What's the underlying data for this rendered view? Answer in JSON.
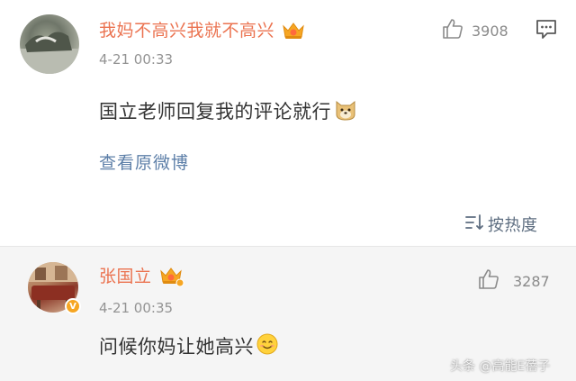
{
  "comment1": {
    "username": "我妈不高兴我就不高兴",
    "time": "4-21 00:33",
    "text": "国立老师回复我的评论就行",
    "likes": "3908",
    "view_original": "查看原微博"
  },
  "sort": {
    "label": "按热度"
  },
  "reply": {
    "username": "张国立",
    "time": "4-21 00:35",
    "text": "问候你妈让她高兴",
    "likes": "3287"
  },
  "watermark": "头条 @高能E蓓子",
  "icons": {
    "like": "thumbs-up-icon",
    "comment": "comment-icon",
    "sort": "sort-icon",
    "crown": "vip-crown-icon",
    "emoji_doge": "doge-emoji-icon",
    "emoji_smile": "smile-emoji-icon",
    "verified": "verified-v-icon"
  },
  "colors": {
    "username": "#eb7350",
    "link": "#5d7fa8",
    "crown": "#f6a623"
  }
}
